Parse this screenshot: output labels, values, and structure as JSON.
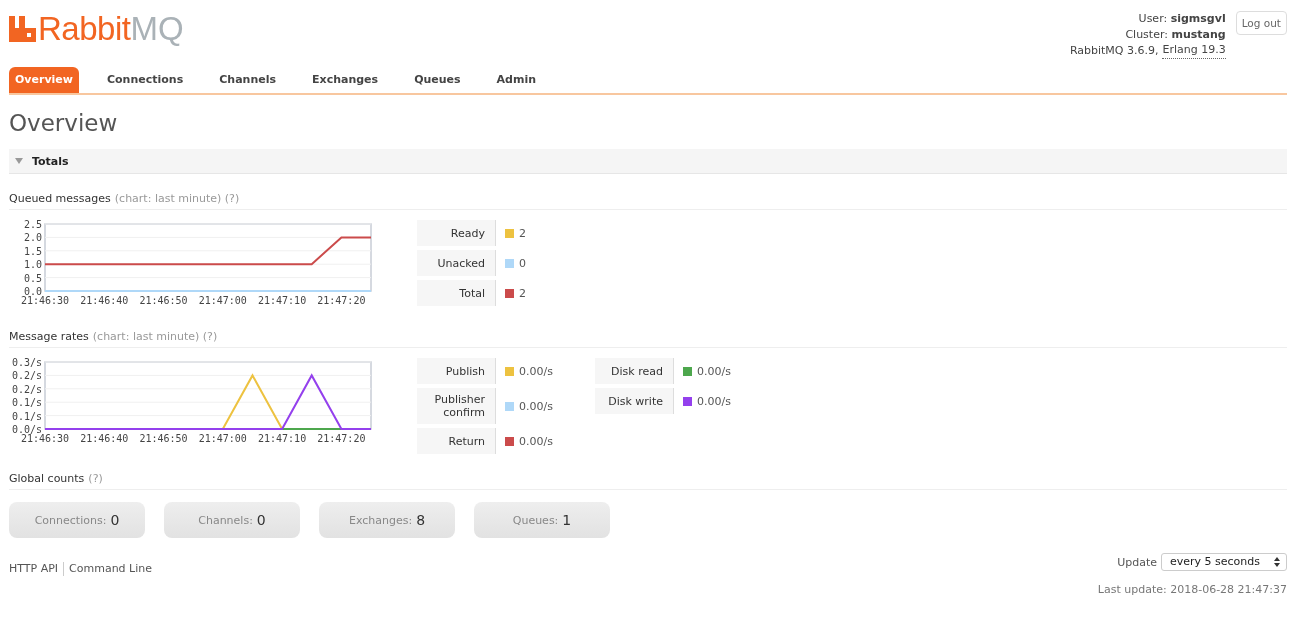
{
  "header": {
    "logo": {
      "name": "Rabbit",
      "suffix": "MQ"
    },
    "user": "User: **sigmsgvl**",
    "cluster": "Cluster: **mustang**",
    "version": "RabbitMQ 3.6.9,",
    "erlang_link": "Erlang 19.3",
    "logout_button": "Log out"
  },
  "tabs": [
    {
      "label": "Overview",
      "selected": true
    },
    {
      "label": "Connections",
      "selected": false
    },
    {
      "label": "Channels",
      "selected": false
    },
    {
      "label": "Exchanges",
      "selected": false
    },
    {
      "label": "Queues",
      "selected": false
    },
    {
      "label": "Admin",
      "selected": false
    }
  ],
  "page_title": "Overview",
  "section": {
    "title": "Totals",
    "expanded": true
  },
  "queued_messages": {
    "title": "Queued messages",
    "hint": "(chart: last minute) (?)",
    "chart_data": {
      "type": "line",
      "grid": true,
      "categories": [
        "21:46:30",
        null,
        "21:46:40",
        null,
        "21:46:50",
        null,
        "21:47:00",
        null,
        "21:47:10",
        null,
        "21:47:20",
        null
      ],
      "ylim": [
        0,
        2.5
      ],
      "yticks": [
        {
          "value": 0,
          "label": "0.0"
        },
        {
          "value": 0.5,
          "label": "0.5"
        },
        {
          "value": 1,
          "label": "1.0"
        },
        {
          "value": 1.5,
          "label": "1.5"
        },
        {
          "value": 2,
          "label": "2.0"
        },
        {
          "value": 2.5,
          "label": "2.5"
        }
      ],
      "series": [
        {
          "name": "Ready",
          "color": "#edc240",
          "values": [
            null,
            null,
            null,
            null,
            null,
            null,
            null,
            null,
            null,
            null,
            null,
            null
          ]
        },
        {
          "name": "Unacked",
          "color": "#afd8f8",
          "values": [
            0,
            0,
            0,
            0,
            0,
            0,
            0,
            0,
            0,
            0,
            0,
            0
          ]
        },
        {
          "name": "Total",
          "color": "#cb4b4b",
          "values": [
            1,
            1,
            1,
            1,
            1,
            1,
            1,
            1,
            1,
            1,
            2,
            2
          ]
        }
      ]
    },
    "legend_columns": [
      [
        {
          "value": "2"
        },
        {
          "value": "0"
        },
        {
          "value": "2"
        }
      ]
    ]
  },
  "message_rates": {
    "title": "Message rates",
    "hint": "(chart: last minute) (?)",
    "chart_data": {
      "type": "line",
      "grid": true,
      "categories": [
        "21:46:30",
        null,
        "21:46:40",
        null,
        "21:46:50",
        null,
        "21:47:00",
        null,
        "21:47:10",
        null,
        "21:47:20",
        null
      ],
      "ylim": [
        0,
        0.25
      ],
      "yticks": [
        {
          "value": 0,
          "label": "0.0/s"
        },
        {
          "value": 0.05,
          "label": "0.1/s"
        },
        {
          "value": 0.1,
          "label": "0.1/s"
        },
        {
          "value": 0.15,
          "label": "0.2/s"
        },
        {
          "value": 0.2,
          "label": "0.2/s"
        },
        {
          "value": 0.25,
          "label": "0.3/s"
        }
      ],
      "series": [
        {
          "name": "Publish",
          "color": "#edc240",
          "values": [
            null,
            null,
            null,
            null,
            null,
            null,
            0,
            0.2,
            0,
            null,
            null,
            null
          ]
        },
        {
          "name": "Publisher confirm",
          "color": "#afd8f8",
          "values": [
            null,
            null,
            null,
            null,
            null,
            null,
            null,
            null,
            null,
            null,
            null,
            null
          ]
        },
        {
          "name": "Return",
          "color": "#cb4b4b",
          "values": [
            null,
            null,
            null,
            null,
            null,
            null,
            null,
            null,
            null,
            null,
            null,
            null
          ]
        },
        {
          "name": "Disk read",
          "color": "#4da74d",
          "values": [
            null,
            null,
            null,
            null,
            null,
            null,
            null,
            null,
            0,
            0,
            0,
            null
          ]
        },
        {
          "name": "Disk write",
          "color": "#9440ed",
          "values": [
            0,
            0,
            0,
            0,
            0,
            0,
            0,
            0,
            0,
            0.2,
            0,
            0
          ]
        }
      ]
    },
    "legend_columns": [
      [
        {
          "value": "0.00/s"
        },
        {
          "value": "0.00/s"
        },
        {
          "value": "0.00/s"
        }
      ],
      [
        {
          "value": "0.00/s"
        },
        {
          "value": "0.00/s"
        }
      ]
    ]
  },
  "global_counts": {
    "title": "Global counts",
    "hint": "(?)",
    "counts": [
      {
        "label": "Connections:",
        "value": "0"
      },
      {
        "label": "Channels:",
        "value": "0"
      },
      {
        "label": "Exchanges:",
        "value": "8"
      },
      {
        "label": "Queues:",
        "value": "1"
      }
    ]
  },
  "footer": {
    "links": [
      "HTTP API",
      "Command Line"
    ],
    "update_label": "Update",
    "update_value": "every 5 seconds",
    "last_update": "Last update: 2018-06-28 21:47:37"
  }
}
